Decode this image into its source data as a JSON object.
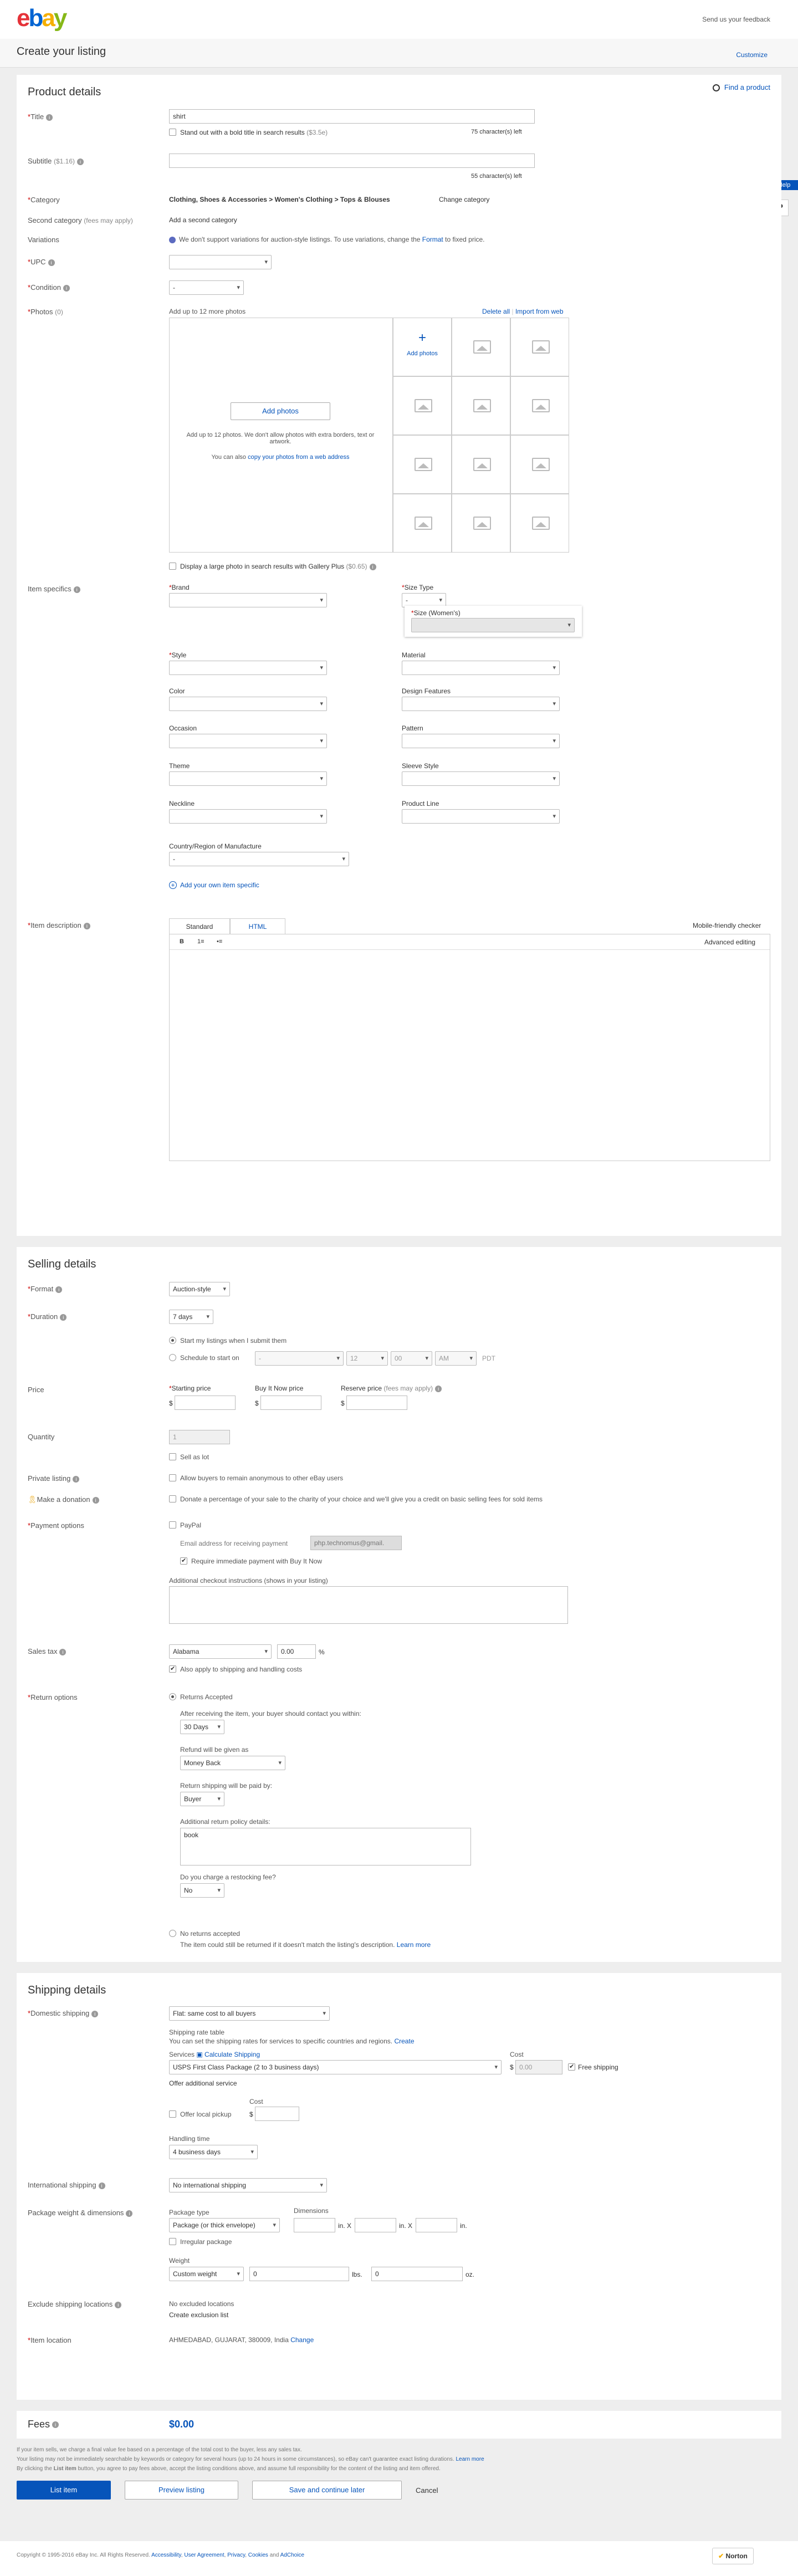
{
  "header": {
    "logo_e": "e",
    "logo_b": "b",
    "logo_a": "a",
    "logo_y": "y",
    "feedback": "Send us your feedback",
    "page_title": "Create your listing",
    "customize": "Customize"
  },
  "side": {
    "help": "Help",
    "question": "?"
  },
  "product": {
    "section_title": "Product details",
    "find_product": "Find a product",
    "title_label": "Title",
    "title_value": "shirt",
    "bold_title": "Stand out with a bold title in search results",
    "bold_fee": "($3.5e)",
    "title_chars_left": "75 character(s) left",
    "subtitle_label": "Subtitle",
    "subtitle_fee": "($1.16)",
    "subtitle_chars_left": "55 character(s) left",
    "category_label": "Category",
    "category_value": "Clothing, Shoes & Accessories > Women's Clothing > Tops & Blouses",
    "change_category": "Change category",
    "second_category_label": "Second category",
    "second_category_fee": "(fees may apply)",
    "add_second_category": "Add a second category",
    "variations_label": "Variations",
    "variations_text_1": "We don't support variations for auction-style listings. To use variations, change the",
    "variations_format": "Format",
    "variations_text_2": "to fixed price.",
    "upc_label": "UPC",
    "condition_label": "Condition",
    "condition_value": "-",
    "photos_label": "Photos",
    "photos_count": "(0)",
    "photos_hint": "Add up to 12 more photos",
    "delete_all": "Delete all",
    "import_web": "Import from web",
    "add_photos_button": "Add photos",
    "photos_desc": "Add up to 12 photos. We don't allow photos with extra borders, text or artwork.",
    "copy_photos_1": "You can also",
    "copy_photos_link": "copy your photos from a web address",
    "add_photos_tile": "Add photos",
    "gallery_plus": "Display a large photo in search results with Gallery Plus",
    "gallery_fee": "($0.65)",
    "item_specifics_label": "Item specifics",
    "brand_label": "Brand",
    "size_type_label": "Size Type",
    "size_type_value": "-",
    "size_womens_label": "Size (Women's)",
    "style_label": "Style",
    "material_label": "Material",
    "color_label": "Color",
    "design_label": "Design Features",
    "occasion_label": "Occasion",
    "pattern_label": "Pattern",
    "theme_label": "Theme",
    "sleeve_label": "Sleeve Style",
    "neckline_label": "Neckline",
    "product_line_label": "Product Line",
    "country_label": "Country/Region of Manufacture",
    "country_value": "-",
    "add_specific": "Add your own item specific",
    "description_label": "Item description",
    "tab_standard": "Standard",
    "tab_html": "HTML",
    "mobile_checker": "Mobile-friendly checker",
    "advanced_editing": "Advanced editing",
    "tool_bold": "B",
    "tool_ol": "1≡",
    "tool_ul": "•≡"
  },
  "selling": {
    "section_title": "Selling details",
    "format_label": "Format",
    "format_value": "Auction-style",
    "duration_label": "Duration",
    "duration_value": "7 days",
    "start_immediately": "Start my listings when I submit them",
    "schedule": "Schedule to start on",
    "schedule_date": "-",
    "schedule_hour": "12",
    "schedule_min": "00",
    "schedule_ampm": "AM",
    "schedule_tz": "PDT",
    "price_label": "Price",
    "starting_price": "Starting price",
    "buy_now_price": "Buy It Now price",
    "reserve_price": "Reserve price",
    "reserve_fee": "(fees may apply)",
    "currency": "$",
    "quantity_label": "Quantity",
    "quantity_value": "1",
    "sell_as_lot": "Sell as lot",
    "private_label": "Private listing",
    "private_text": "Allow buyers to remain anonymous to other eBay users",
    "donation_label": "Make a donation",
    "donation_text": "Donate a percentage of your sale to the charity of your choice and we'll give you a credit on basic selling fees for sold items",
    "payment_label": "Payment options",
    "paypal": "PayPal",
    "email_label": "Email address for receiving payment",
    "email_value": "php.technomus@gmail.",
    "immediate_payment": "Require immediate payment with Buy It Now",
    "checkout_instr": "Additional checkout instructions (shows in your listing)",
    "tax_label": "Sales tax",
    "tax_state": "Alabama",
    "tax_rate": "0.00",
    "tax_pct": "%",
    "tax_shipping": "Also apply to shipping and handling costs",
    "return_label": "Return options",
    "returns_accepted": "Returns Accepted",
    "contact_within": "After receiving the item, your buyer should contact you within:",
    "contact_value": "30 Days",
    "refund_label": "Refund will be given as",
    "refund_value": "Money Back",
    "return_paid_label": "Return shipping will be paid by:",
    "return_paid_value": "Buyer",
    "policy_label": "Additional return policy details:",
    "policy_value": "book",
    "restocking_label": "Do you charge a restocking fee?",
    "restocking_value": "No",
    "no_returns": "No returns accepted",
    "no_returns_note": "The item could still be returned if it doesn't match the listing's description.",
    "learn_more": "Learn more"
  },
  "shipping": {
    "section_title": "Shipping details",
    "domestic_label": "Domestic shipping",
    "domestic_value": "Flat: same cost to all buyers",
    "rate_table": "Shipping rate table",
    "rate_table_text": "You can set the shipping rates for services to specific countries and regions.",
    "create": "Create",
    "services": "Services",
    "calculate": "Calculate Shipping",
    "cost": "Cost",
    "service_value": "USPS First Class Package (2 to 3 business days)",
    "cost_value": "0.00",
    "free_shipping": "Free shipping",
    "offer_additional": "Offer additional service",
    "local_pickup": "Offer local pickup",
    "handling_label": "Handling time",
    "handling_value": "4 business days",
    "intl_label": "International shipping",
    "intl_value": "No international shipping",
    "package_label": "Package weight & dimensions",
    "package_type": "Package type",
    "package_value": "Package (or thick envelope)",
    "dimensions": "Dimensions",
    "in": "in.",
    "x": "X",
    "irregular": "Irregular package",
    "weight": "Weight",
    "weight_value": "Custom weight",
    "weight_lbs": "0",
    "lbs": "lbs.",
    "weight_oz": "0",
    "oz": "oz.",
    "exclude_label": "Exclude shipping locations",
    "no_excluded": "No excluded locations",
    "create_exclusion": "Create exclusion list",
    "location_label": "Item location",
    "location_value": "AHMEDABAD, GUJARAT, 380009, India",
    "change": "Change"
  },
  "fees": {
    "label": "Fees",
    "value": "$0.00",
    "note1": "If your item sells, we charge a final value fee based on a percentage of the total cost to the buyer, less any sales tax.",
    "note2a": "Your listing may not be immediately searchable by keywords or category for several hours (up to 24 hours in some circumstances), so eBay can't guarantee exact listing durations.",
    "note2b": "Learn more",
    "note3a": "By clicking the",
    "note3b": "List item",
    "note3c": "button, you agree to pay fees above, accept the listing conditions above, and assume full responsibility for the content of the listing and item offered."
  },
  "actions": {
    "list_item": "List item",
    "preview": "Preview listing",
    "save": "Save and continue later",
    "cancel": "Cancel"
  },
  "footer": {
    "copyright": "Copyright © 1995-2016 eBay Inc. All Rights Reserved.",
    "accessibility": "Accessibility",
    "user_agreement": "User Agreement",
    "privacy": "Privacy",
    "cookies": "Cookies",
    "and": "and",
    "adchoice": "AdChoice",
    "norton": "Norton"
  }
}
